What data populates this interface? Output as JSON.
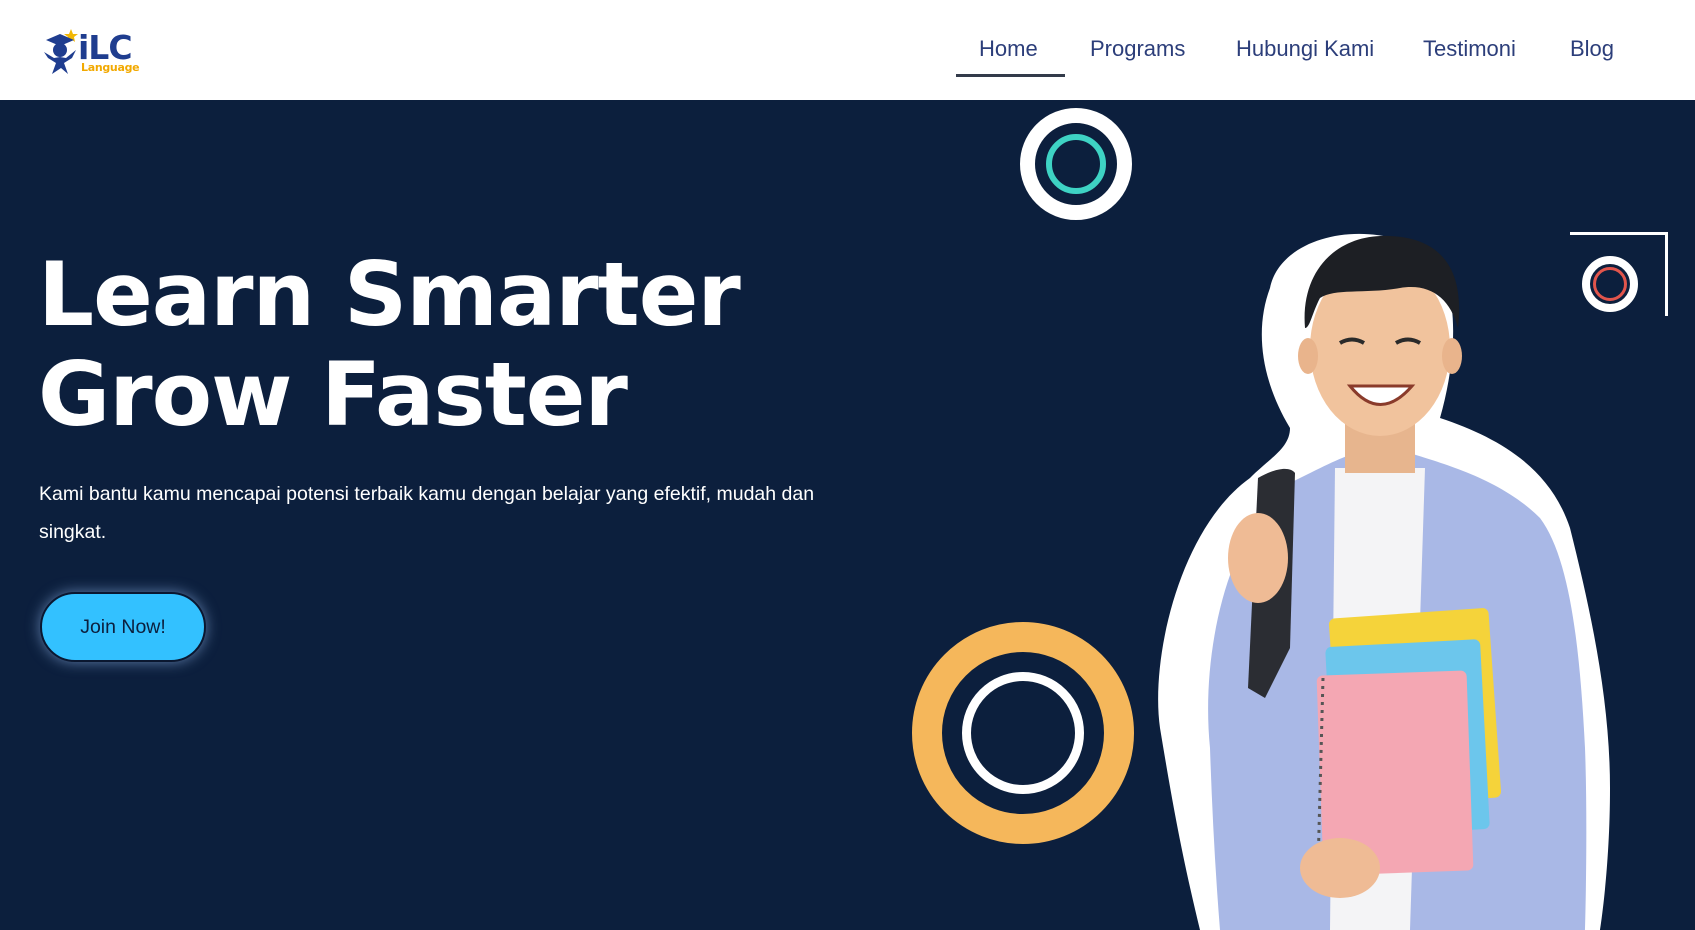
{
  "header": {
    "logo": {
      "main": "iLC",
      "sub": "Language"
    },
    "nav": [
      {
        "label": "Home",
        "active": true
      },
      {
        "label": "Programs",
        "active": false
      },
      {
        "label": "Hubungi Kami",
        "active": false
      },
      {
        "label": "Testimoni",
        "active": false
      },
      {
        "label": "Blog",
        "active": false
      }
    ]
  },
  "hero": {
    "title_line1": "Learn Smarter",
    "title_line2": "Grow Faster",
    "subtitle": "Kami bantu kamu mencapai potensi terbaik kamu dengan belajar yang efektif, mudah dan singkat.",
    "cta_label": "Join Now!"
  },
  "colors": {
    "background": "#0c1f3d",
    "cta": "#33c1ff",
    "accent_teal": "#3ed3c4",
    "accent_yellow": "#f5b75b",
    "accent_red": "#e2554c",
    "nav_text": "#2c3e7a"
  },
  "icons": {
    "logo_mascot": "graduate-star-icon"
  }
}
